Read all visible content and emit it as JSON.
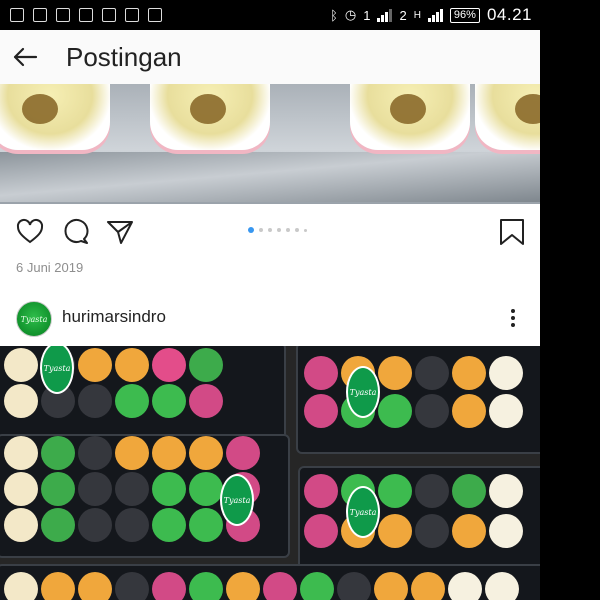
{
  "status_bar": {
    "battery": "96%",
    "time": "04.21",
    "sim1": "1",
    "sim2": "2",
    "network": "H"
  },
  "app_bar": {
    "title": "Postingan"
  },
  "post_actions": {
    "carousel_count": 7,
    "carousel_active": 1
  },
  "next_post": {
    "date": "6 Juni 2019",
    "username": "hurimarsindro"
  },
  "colors": {
    "accent_blue": "#3897f0",
    "brand_green": "#0f9a4a"
  },
  "icons": [
    "arrow-back-icon",
    "heart-icon",
    "comment-icon",
    "share-icon",
    "bookmark-icon",
    "more-vertical-icon"
  ]
}
